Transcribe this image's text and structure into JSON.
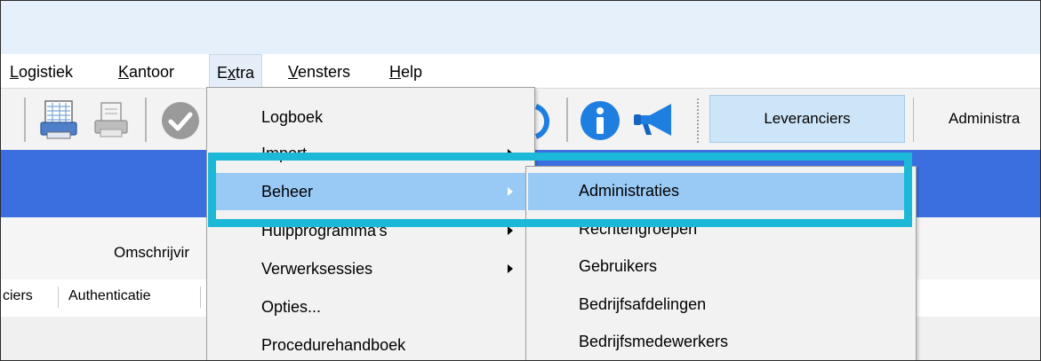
{
  "menubar": {
    "items": [
      {
        "label": "Logistiek",
        "mnemonic": "L",
        "rest": "ogistiek"
      },
      {
        "label": "Kantoor",
        "mnemonic": "K",
        "rest": "antoor"
      },
      {
        "label": "Extra",
        "mnemonic": "x",
        "pre": "E",
        "rest": "tra"
      },
      {
        "label": "Vensters",
        "mnemonic": "V",
        "rest": "ensters"
      },
      {
        "label": "Help",
        "mnemonic": "H",
        "rest": "elp"
      }
    ]
  },
  "toolbar": {
    "icons": [
      "print-preview-icon",
      "print-icon",
      "checkmark-icon",
      "refresh-icon",
      "info-icon",
      "megaphone-icon"
    ],
    "buttons": [
      {
        "label": "Leveranciers"
      },
      {
        "label": "Administra"
      }
    ]
  },
  "grid": {
    "column_header": "Omschrijvir"
  },
  "tabs": [
    {
      "label": "ciers"
    },
    {
      "label": "Authenticatie"
    }
  ],
  "extra_menu": {
    "items": [
      {
        "label": "Logboek",
        "submenu": false
      },
      {
        "label": "Import",
        "submenu": true
      },
      {
        "label": "Beheer",
        "submenu": true,
        "highlighted": true
      },
      {
        "label": "Hulpprogramma's",
        "submenu": true
      },
      {
        "label": "Verwerksessies",
        "submenu": true
      },
      {
        "label": "Opties...",
        "submenu": false
      },
      {
        "label": "Procedurehandboek",
        "submenu": false
      }
    ]
  },
  "beheer_submenu": {
    "items": [
      {
        "label": "Administraties",
        "highlighted": true
      },
      {
        "label": "Rechtengroepen"
      },
      {
        "label": "Gebruikers"
      },
      {
        "label": "Bedrijfsafdelingen"
      },
      {
        "label": "Bedrijfsmedewerkers"
      }
    ]
  },
  "colors": {
    "menu_highlight": "#99c9f5",
    "blue_band": "#3b6fe0",
    "annotation_box": "#1cb8d8",
    "toolbar_button": "#cde5f8",
    "info_icon": "#1e7fe0",
    "check_icon": "#9a9a9a"
  }
}
